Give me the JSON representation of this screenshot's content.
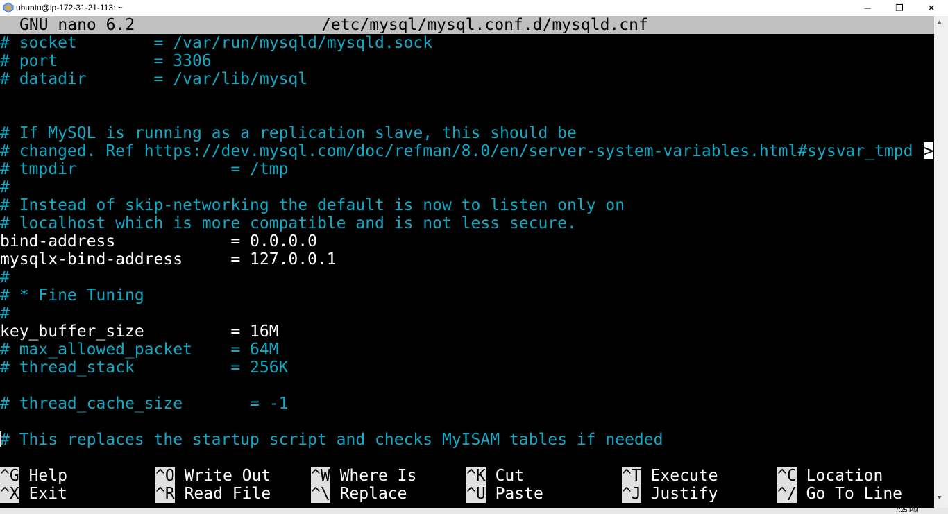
{
  "window": {
    "title": "ubuntu@ip-172-31-21-113: ~",
    "min_glyph": "─",
    "max_glyph": "❐",
    "close_glyph": "✕"
  },
  "editor": {
    "version": "GNU nano 6.2",
    "filename": "/etc/mysql/mysql.conf.d/mysqld.cnf",
    "truncation_marker": ">",
    "lines": [
      "# socket        = /var/run/mysqld/mysqld.sock",
      "# port          = 3306",
      "# datadir       = /var/lib/mysql",
      "",
      "",
      "# If MySQL is running as a replication slave, this should be",
      "# changed. Ref https://dev.mysql.com/doc/refman/8.0/en/server-system-variables.html#sysvar_tmpd",
      "# tmpdir                = /tmp",
      "#",
      "# Instead of skip-networking the default is now to listen only on",
      "# localhost which is more compatible and is not less secure.",
      "bind-address            = 0.0.0.0",
      "mysqlx-bind-address     = 127.0.0.1",
      "#",
      "# * Fine Tuning",
      "#",
      "key_buffer_size         = 16M",
      "# max_allowed_packet    = 64M",
      "# thread_stack          = 256K",
      "",
      "# thread_cache_size       = -1",
      "",
      "# This replaces the startup script and checks MyISAM tables if needed"
    ],
    "line_kinds": [
      "c",
      "c",
      "c",
      "w",
      "w",
      "c",
      "c",
      "c",
      "c",
      "c",
      "c",
      "w",
      "w",
      "c",
      "c",
      "c",
      "w",
      "c",
      "c",
      "w",
      "c",
      "w",
      "c"
    ]
  },
  "shortcuts": {
    "row1": [
      {
        "key": "^G",
        "label": "Help"
      },
      {
        "key": "^O",
        "label": "Write Out"
      },
      {
        "key": "^W",
        "label": "Where Is"
      },
      {
        "key": "^K",
        "label": "Cut"
      },
      {
        "key": "^T",
        "label": "Execute"
      },
      {
        "key": "^C",
        "label": "Location"
      }
    ],
    "row2": [
      {
        "key": "^X",
        "label": "Exit"
      },
      {
        "key": "^R",
        "label": "Read File"
      },
      {
        "key": "^\\",
        "label": "Replace"
      },
      {
        "key": "^U",
        "label": "Paste"
      },
      {
        "key": "^J",
        "label": "Justify"
      },
      {
        "key": "^/",
        "label": "Go To Line"
      }
    ]
  },
  "taskbar": {
    "clock": "7:25 PM"
  },
  "colors": {
    "comment": "#13a9c4",
    "text": "#ffffff",
    "header_bg": "#c0c0c0",
    "background": "#000000"
  }
}
